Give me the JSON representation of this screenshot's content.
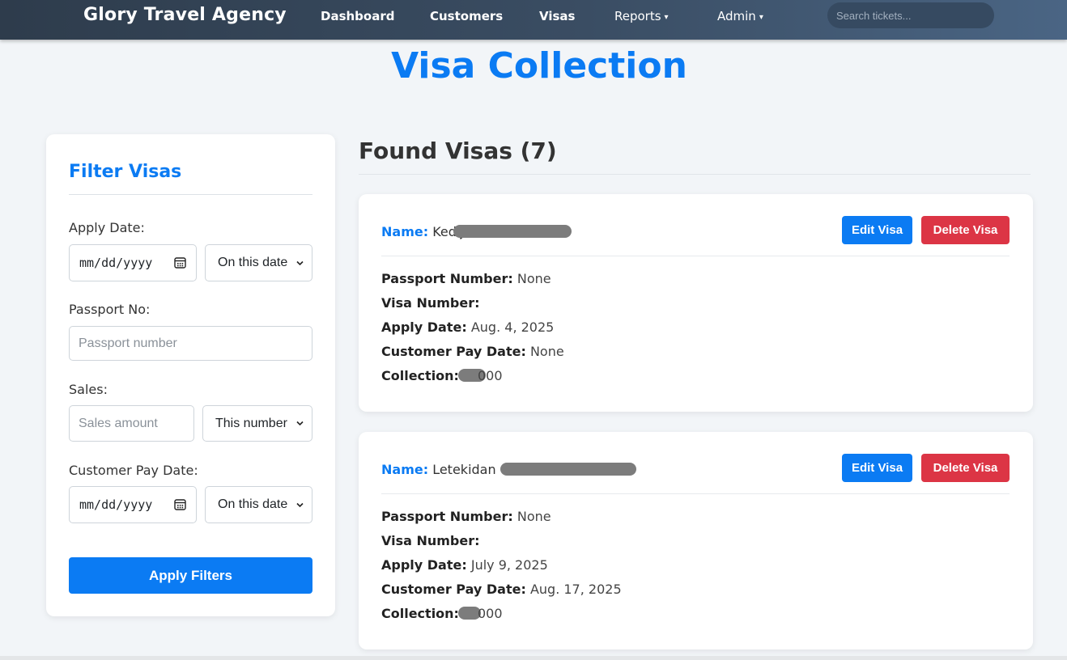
{
  "navbar": {
    "brand": "Glory Travel Agency",
    "items": [
      {
        "label": "Dashboard"
      },
      {
        "label": "Customers"
      },
      {
        "label": "Visas"
      },
      {
        "label": "Reports",
        "dropdown": true
      },
      {
        "label": "Admin",
        "dropdown": true
      }
    ],
    "caret": "▾",
    "search_placeholder": "Search tickets..."
  },
  "page_title": "Visa Collection",
  "filter": {
    "title": "Filter Visas",
    "apply_date": {
      "label": "Apply Date:",
      "placeholder": "mm/dd/yyyy",
      "mode": "On this date"
    },
    "passport": {
      "label": "Passport No:",
      "placeholder": "Passport number"
    },
    "sales": {
      "label": "Sales:",
      "placeholder": "Sales amount",
      "mode": "This number"
    },
    "customer_pay_date": {
      "label": "Customer Pay Date:",
      "placeholder": "mm/dd/yyyy",
      "mode": "On this date"
    },
    "apply_button": "Apply Filters"
  },
  "results": {
    "heading": "Found Visas (7)",
    "labels": {
      "name": "Name:",
      "passport_number": "Passport Number:",
      "visa_number": "Visa Number:",
      "apply_date": "Apply Date:",
      "customer_pay_date": "Customer Pay Date:",
      "collection": "Collection:",
      "edit_button": "Edit Visa",
      "delete_button": "Delete Visa"
    },
    "visas": [
      {
        "name_visible": "Kedija",
        "passport_number": "None",
        "visa_number": "",
        "apply_date": "Aug. 4, 2025",
        "customer_pay_date": "None",
        "collection_visible": "000"
      },
      {
        "name_visible": "Letekidan",
        "passport_number": "None",
        "visa_number": "",
        "apply_date": "July 9, 2025",
        "customer_pay_date": "Aug. 17, 2025",
        "collection_visible": "000"
      }
    ]
  },
  "colors": {
    "accent": "#0b7bf3",
    "danger": "#dc3545",
    "navbar": "#33445a"
  }
}
